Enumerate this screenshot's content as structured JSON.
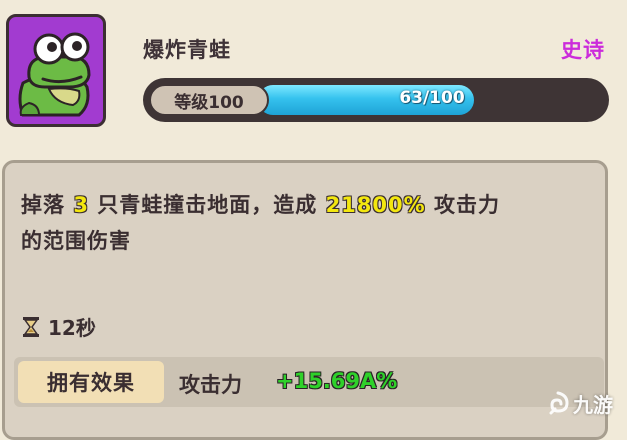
{
  "skill": {
    "name": "爆炸青蛙",
    "rarity": "史诗",
    "level_label": "等级100",
    "progress_text": "63/100",
    "progress_fraction": 0.63
  },
  "description": {
    "line1_pre": "掉落",
    "line1_num": "3",
    "line1_mid": "只青蛙撞击地面，造成",
    "line1_pct": "21800%",
    "line1_post": "攻击力",
    "line2": "的范围伤害"
  },
  "cooldown": {
    "icon": "hourglass-icon",
    "text": "12秒"
  },
  "effect": {
    "label": "拥有效果",
    "stat": "攻击力",
    "value": "+15.69A%"
  },
  "watermark": {
    "text": "九游",
    "icon": "swirl-logo-icon"
  },
  "colors": {
    "icon_bg": "#a23bd0",
    "rarity": "#cb2bdb",
    "progress": "#35c2ee",
    "highlight": "#f3e70f",
    "effect_value": "#2fd12a"
  }
}
